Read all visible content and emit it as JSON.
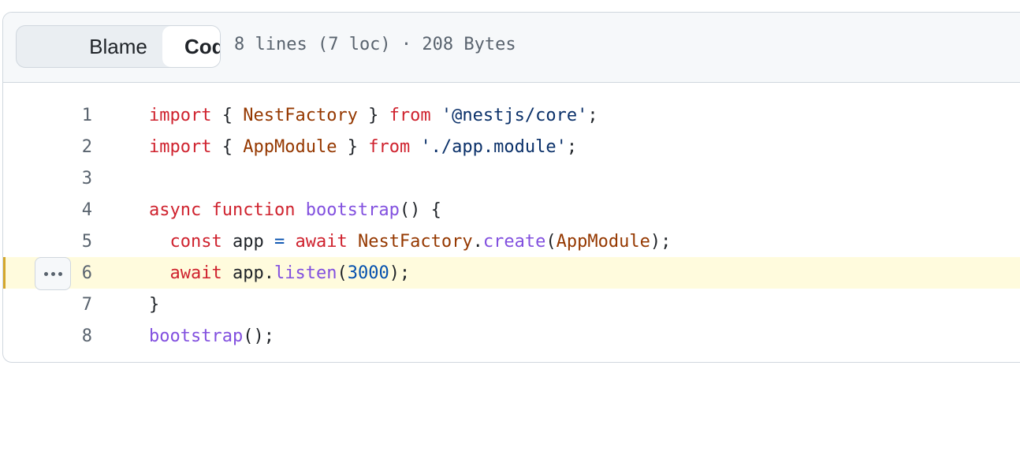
{
  "toolbar": {
    "code_label": "Code",
    "blame_label": "Blame",
    "file_info": "8 lines (7 loc) · 208 Bytes"
  },
  "code": {
    "highlighted_line": 6,
    "lines": [
      {
        "number": "1",
        "tokens": [
          {
            "t": "import",
            "c": "kw"
          },
          {
            "t": " { "
          },
          {
            "t": "NestFactory",
            "c": "ent"
          },
          {
            "t": " } "
          },
          {
            "t": "from",
            "c": "kw"
          },
          {
            "t": " "
          },
          {
            "t": "'@nestjs/core'",
            "c": "str"
          },
          {
            "t": ";"
          }
        ]
      },
      {
        "number": "2",
        "tokens": [
          {
            "t": "import",
            "c": "kw"
          },
          {
            "t": " { "
          },
          {
            "t": "AppModule",
            "c": "ent"
          },
          {
            "t": " } "
          },
          {
            "t": "from",
            "c": "kw"
          },
          {
            "t": " "
          },
          {
            "t": "'./app.module'",
            "c": "str"
          },
          {
            "t": ";"
          }
        ]
      },
      {
        "number": "3",
        "tokens": []
      },
      {
        "number": "4",
        "tokens": [
          {
            "t": "async",
            "c": "kw"
          },
          {
            "t": " "
          },
          {
            "t": "function",
            "c": "kw"
          },
          {
            "t": " "
          },
          {
            "t": "bootstrap",
            "c": "fn"
          },
          {
            "t": "() {"
          }
        ]
      },
      {
        "number": "5",
        "tokens": [
          {
            "t": "  "
          },
          {
            "t": "const",
            "c": "kw"
          },
          {
            "t": " app "
          },
          {
            "t": "=",
            "c": "op"
          },
          {
            "t": " "
          },
          {
            "t": "await",
            "c": "kw"
          },
          {
            "t": " "
          },
          {
            "t": "NestFactory",
            "c": "ent"
          },
          {
            "t": "."
          },
          {
            "t": "create",
            "c": "fn"
          },
          {
            "t": "("
          },
          {
            "t": "AppModule",
            "c": "ent"
          },
          {
            "t": ");"
          }
        ]
      },
      {
        "number": "6",
        "tokens": [
          {
            "t": "  "
          },
          {
            "t": "await",
            "c": "kw"
          },
          {
            "t": " app."
          },
          {
            "t": "listen",
            "c": "fn"
          },
          {
            "t": "("
          },
          {
            "t": "3000",
            "c": "num"
          },
          {
            "t": ");"
          }
        ]
      },
      {
        "number": "7",
        "tokens": [
          {
            "t": "}"
          }
        ]
      },
      {
        "number": "8",
        "tokens": [
          {
            "t": "bootstrap",
            "c": "fn"
          },
          {
            "t": "();"
          }
        ]
      }
    ]
  },
  "icons": {
    "line_menu": "kebab-horizontal-icon"
  },
  "colors": {
    "keyword": "#cf222e",
    "entity": "#953800",
    "string": "#0a3069",
    "function": "#8250df",
    "number": "#0550ae",
    "highlight_bg": "#fffbdd",
    "highlight_bar": "#d4a72c"
  }
}
